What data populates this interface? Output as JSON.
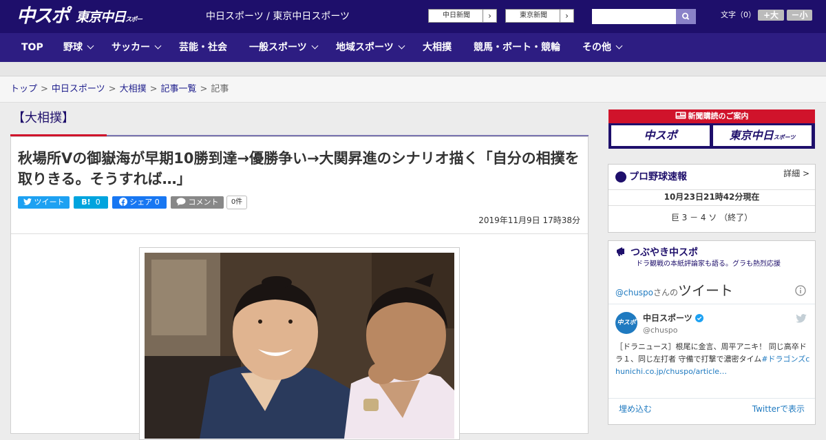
{
  "header": {
    "logo_main": "中スポ",
    "logo_tokyo": "東京中日",
    "logo_tokyo_small": "スポーツ",
    "site_title": "中日スポーツ / 東京中日スポーツ",
    "buttons": [
      {
        "label": "中日新聞",
        "arrow": "›"
      },
      {
        "label": "東京新聞",
        "arrow": "›"
      }
    ],
    "search_placeholder": "",
    "font_label": "文字（0）",
    "font_plus": "+大",
    "font_minus": "－小"
  },
  "nav": {
    "items": [
      {
        "label": "TOP",
        "dropdown": false
      },
      {
        "label": "野球",
        "dropdown": true
      },
      {
        "label": "サッカー",
        "dropdown": true
      },
      {
        "label": "芸能・社会",
        "dropdown": false
      },
      {
        "label": "一般スポーツ",
        "dropdown": true
      },
      {
        "label": "地域スポーツ",
        "dropdown": true
      },
      {
        "label": "大相撲",
        "dropdown": false
      },
      {
        "label": "競馬・ボート・競輪",
        "dropdown": false
      },
      {
        "label": "その他",
        "dropdown": true
      }
    ]
  },
  "breadcrumb": {
    "items": [
      "トップ",
      "中日スポーツ",
      "大相撲",
      "記事一覧"
    ],
    "separator": ">",
    "current": "記事"
  },
  "article": {
    "category": "【大相撲】",
    "headline": "秋場所Vの御嶽海が早期10勝到達→優勝争い→大関昇進のシナリオ描く「自分の相撲を取りきる。そうすれば…」",
    "share": {
      "tweet": "ツイート",
      "hatena": "B!",
      "hatena_count": "0",
      "facebook": "シェア",
      "facebook_count": "0",
      "comment": "コメント",
      "comment_count": "0件"
    },
    "date": "2019年11月9日 17時38分"
  },
  "sidebar": {
    "ad": {
      "title": "新聞購読のご案内",
      "left": "中スポ",
      "right": "東京中日",
      "right_small": "スポーツ"
    },
    "baseball": {
      "title": "プロ野球速報",
      "detail": "詳細 >",
      "updated": "10月23日21時42分現在",
      "score": "巨 3 － 4 ソ （終了）"
    },
    "tsubuyaki": {
      "title": "つぶやき中スポ",
      "subtitle": "ドラ観戦の本紙評論家も語る。グラも熱烈応援",
      "handle_prefix": "@chuspo",
      "handle_mid": "さんの",
      "heading": "ツイート",
      "account_name": "中日スポーツ",
      "account_handle": "@chuspo",
      "avatar_text": "中スポ",
      "tweet_text": "［ドラニュース］根尾に金言、周平アニキ！ 同じ高卒ドラ１、同じ左打者 守備で打撃で濃密タイム",
      "tweet_hashtag": "#ドラゴンズ",
      "tweet_url": "chunichi.co.jp/chuspo/article…",
      "embed": "埋め込む",
      "view_on": "Twitterで表示"
    }
  },
  "colors": {
    "header_bg": "#1e0f6b",
    "nav_bg": "#2d1d82",
    "accent_red": "#d0132b",
    "twitter": "#1da1f2",
    "hatena": "#00a4de",
    "facebook": "#1877f2",
    "comment": "#888888"
  }
}
